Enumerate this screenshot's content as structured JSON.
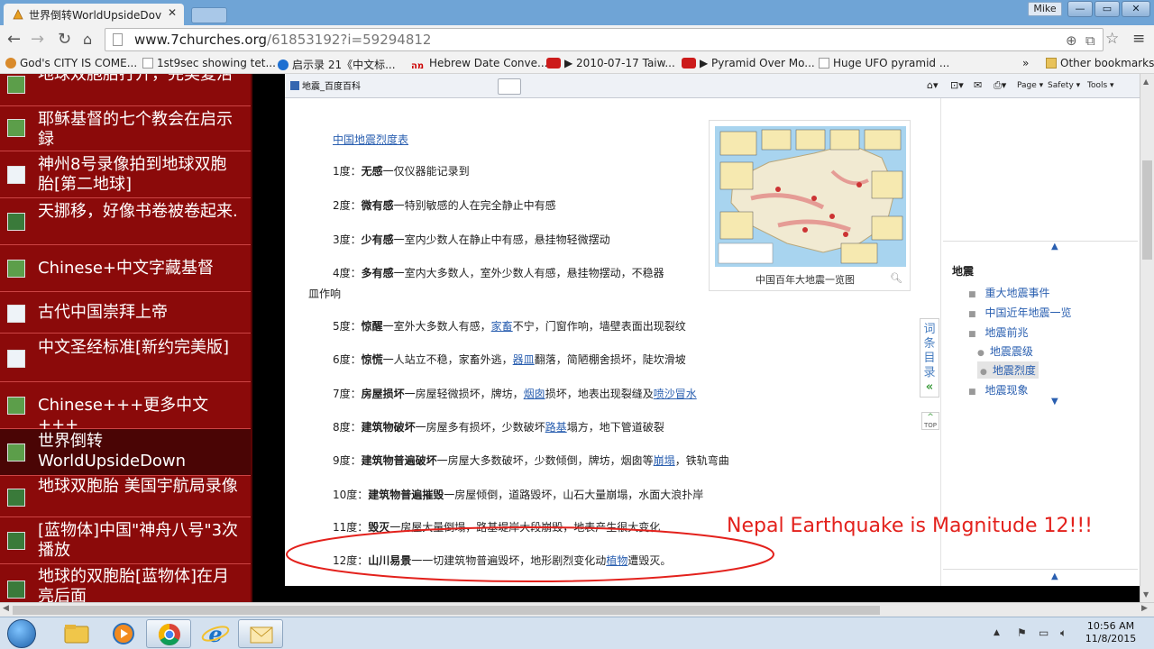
{
  "tab": {
    "title": "世界倒转WorldUpsideDov",
    "close": "✕"
  },
  "window": {
    "user": "Mike",
    "min": "—",
    "max": "▭",
    "close": "✕"
  },
  "address": {
    "domain": "www.7churches.org",
    "path": "/61853192?i=59294812"
  },
  "bookmarks": {
    "items": [
      "God's CITY IS COME...",
      "1st9sec showing tet...",
      "启示录 21《中文标...",
      "Hebrew Date Conve...",
      "▶ 2010-07-17 Taiw...",
      "▶ Pyramid Over Mo...",
      "Huge UFO pyramid ..."
    ],
    "overflow": "»",
    "other": "Other bookmarks"
  },
  "sidebar": {
    "items": [
      {
        "label": "地球双胞胎打开，完美复活"
      },
      {
        "label": "耶稣基督的七个教会在启示録"
      },
      {
        "label": "神州8号录像拍到地球双胞胎[第二地球]"
      },
      {
        "label": "天挪移，好像书卷被卷起来."
      },
      {
        "label": "Chinese+中文字藏基督"
      },
      {
        "label": "古代中国崇拜上帝"
      },
      {
        "label": "中文圣经标准[新约完美版]"
      },
      {
        "label": "Chinese+++更多中文+++"
      },
      {
        "label": "世界倒转 WorldUpsideDown"
      },
      {
        "label": "地球双胞胎 美国宇航局录像"
      },
      {
        "label": "[蓝物体]中国\"神舟八号\"3次播放"
      },
      {
        "label": "地球的双胞胎[蓝物体]在月亮后面"
      }
    ]
  },
  "inner": {
    "tab_title": "地震_百度百科",
    "tools": {
      "page": "Page ▾",
      "safety": "Safety ▾",
      "tools": "Tools ▾"
    },
    "toc_link": "中国地震烈度表",
    "levels": [
      {
        "pre": "1度：",
        "bold": "无感",
        "rest": "一仅仪器能记录到"
      },
      {
        "pre": "2度：",
        "bold": "微有感",
        "rest": "一特别敏感的人在完全静止中有感"
      },
      {
        "pre": "3度：",
        "bold": "少有感",
        "rest": "一室内少数人在静止中有感，悬挂物轻微摆动"
      },
      {
        "pre": "4度：",
        "bold": "多有感",
        "rest": "一室内大多数人，室外少数人有感，悬挂物摆动，不稳器",
        "cont": "皿作响"
      },
      {
        "pre": "5度：",
        "bold": "惊醒",
        "rest": "一室外大多数人有感，",
        "link": "家畜",
        "rest2": "不宁，门窗作响，墙壁表面出现裂纹"
      },
      {
        "pre": "6度：",
        "bold": "惊慌",
        "rest": "一人站立不稳，家畜外逃，",
        "link": "器皿",
        "rest2": "翻落，简陋棚舍损坏，陡坎滑坡"
      },
      {
        "pre": "7度：",
        "bold": "房屋损坏",
        "rest": "一房屋轻微损坏，牌坊，",
        "link": "烟囱",
        "rest2": "损坏，地表出现裂缝及",
        "link2": "喷沙冒水"
      },
      {
        "pre": "8度：",
        "bold": "建筑物破坏",
        "rest": "一房屋多有损坏，少数破坏",
        "link": "路基",
        "rest2": "塌方，地下管道破裂"
      },
      {
        "pre": "9度：",
        "bold": "建筑物普遍破坏",
        "rest": "一房屋大多数破坏，少数倾倒，牌坊，烟囱等",
        "link": "崩塌",
        "rest2": "，铁轨弯曲"
      },
      {
        "pre": "10度：",
        "bold": "建筑物普遍摧毁",
        "rest": "一房屋倾倒，道路毁坏，山石大量崩塌，水面大浪扑岸"
      },
      {
        "pre": "11度：",
        "bold": "毁灭",
        "rest": "一房屋大量倒塌，路基堤岸大段崩毁，地表产生很大变化"
      },
      {
        "pre": "12度：",
        "bold": "山川易景",
        "rest": "一一切建筑物普遍毁坏，地形剧烈变化动",
        "link": "植物",
        "rest2": "遭毁灭。"
      }
    ],
    "map_caption": "中国百年大地震一览图",
    "cidian": [
      "词",
      "条",
      "目",
      "录"
    ],
    "top_label": "TOP",
    "toc": {
      "title": "地震",
      "items": [
        {
          "label": "重大地震事件"
        },
        {
          "label": "中国近年地震一览"
        },
        {
          "label": "地震前兆"
        },
        {
          "label": "地震震级"
        },
        {
          "label": "地震烈度"
        },
        {
          "label": "地震现象"
        }
      ]
    },
    "annotation": "Nepal Earthquake is Magnitude 12!!!"
  },
  "clock": {
    "time": "10:56 AM",
    "date": "11/8/2015"
  },
  "colors": {
    "sidebar": "#8b0a0a",
    "annotation": "#e3211c",
    "link": "#2a5fb0"
  }
}
